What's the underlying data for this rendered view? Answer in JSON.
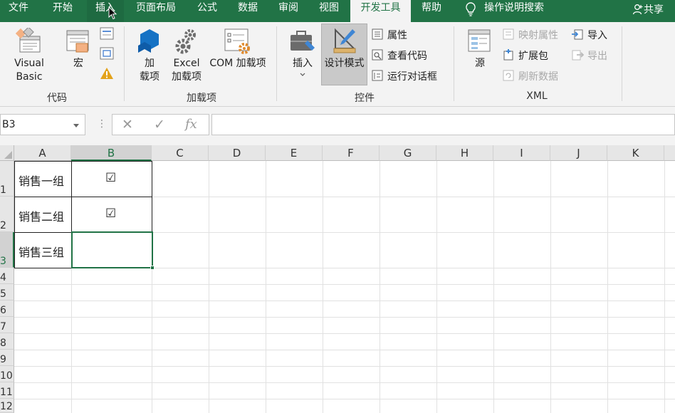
{
  "tabs": [
    {
      "label": "文件"
    },
    {
      "label": "开始"
    },
    {
      "label": "插入"
    },
    {
      "label": "页面布局"
    },
    {
      "label": "公式"
    },
    {
      "label": "数据"
    },
    {
      "label": "审阅"
    },
    {
      "label": "视图"
    },
    {
      "label": "开发工具"
    },
    {
      "label": "帮助"
    }
  ],
  "active_tab": "开发工具",
  "hovered_tab": "插入",
  "tell_me": "操作说明搜索",
  "share": "共享",
  "ribbon": {
    "code": {
      "visual_basic": "Visual Basic",
      "macro": "宏",
      "label": "代码"
    },
    "addins": {
      "add_top": "加",
      "add_bottom": "载项",
      "excel_top": "Excel",
      "excel_bottom": "加载项",
      "com": "COM 加载项",
      "label": "加载项"
    },
    "controls": {
      "insert": "插入",
      "design_mode": "设计模式",
      "properties": "属性",
      "view_code": "查看代码",
      "run_dialog": "运行对话框",
      "label": "控件"
    },
    "xml": {
      "source": "源",
      "map_properties": "映射属性",
      "expansion_packs": "扩展包",
      "refresh_data": "刷新数据",
      "import": "导入",
      "export": "导出",
      "label": "XML"
    }
  },
  "formula_bar": {
    "name_box": "B3",
    "formula": ""
  },
  "columns": [
    "A",
    "B",
    "C",
    "D",
    "E",
    "F",
    "G",
    "H",
    "I",
    "J",
    "K"
  ],
  "rows": [
    "1",
    "2",
    "3",
    "4",
    "5",
    "6",
    "7",
    "8",
    "9",
    "10",
    "11",
    "12"
  ],
  "selected_cell": "B3",
  "cells": {
    "A1": "销售一组",
    "A2": "销售二组",
    "A3": "销售三组",
    "B1": "☑",
    "B2": "☑"
  },
  "colors": {
    "accent": "#217346",
    "ribbon_bg": "#f3f3f3",
    "header_bg": "#e6e6e6"
  }
}
